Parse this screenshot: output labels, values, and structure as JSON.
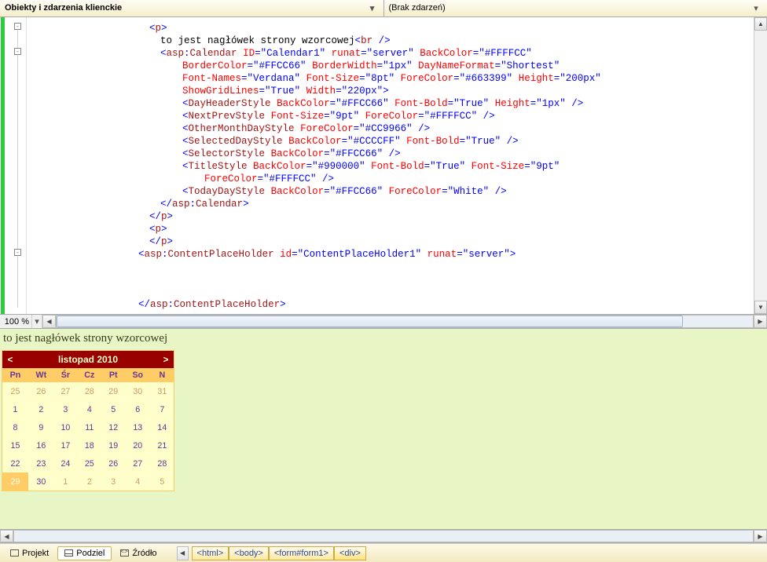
{
  "topbar": {
    "left_label": "Obiekty i zdarzenia klienckie",
    "right_label": "(Brak zdarzeń)"
  },
  "code_lines": [
    {
      "indent": 10,
      "segs": [
        {
          "c": "t-punct",
          "t": "<"
        },
        {
          "c": "t-tag",
          "t": "p"
        },
        {
          "c": "t-punct",
          "t": ">"
        }
      ]
    },
    {
      "indent": 12,
      "segs": [
        {
          "c": "t-black",
          "t": "to jest nagłówek strony wzorcowej"
        },
        {
          "c": "t-punct",
          "t": "<"
        },
        {
          "c": "t-tag",
          "t": "br"
        },
        {
          "c": "t-black",
          "t": " "
        },
        {
          "c": "t-punct",
          "t": "/>"
        }
      ]
    },
    {
      "indent": 12,
      "segs": [
        {
          "c": "t-punct",
          "t": "<"
        },
        {
          "c": "t-tag",
          "t": "asp"
        },
        {
          "c": "t-punct",
          "t": ":"
        },
        {
          "c": "t-tag",
          "t": "Calendar"
        },
        {
          "c": "",
          "t": " "
        },
        {
          "c": "t-attr",
          "t": "ID"
        },
        {
          "c": "t-punct",
          "t": "=\""
        },
        {
          "c": "t-val",
          "t": "Calendar1"
        },
        {
          "c": "t-punct",
          "t": "\" "
        },
        {
          "c": "t-attr",
          "t": "runat"
        },
        {
          "c": "t-punct",
          "t": "=\""
        },
        {
          "c": "t-val",
          "t": "server"
        },
        {
          "c": "t-punct",
          "t": "\" "
        },
        {
          "c": "t-attr",
          "t": "BackColor"
        },
        {
          "c": "t-punct",
          "t": "=\""
        },
        {
          "c": "t-val",
          "t": "#FFFFCC"
        },
        {
          "c": "t-punct",
          "t": "\""
        }
      ]
    },
    {
      "indent": 16,
      "segs": [
        {
          "c": "t-attr",
          "t": "BorderColor"
        },
        {
          "c": "t-punct",
          "t": "=\""
        },
        {
          "c": "t-val",
          "t": "#FFCC66"
        },
        {
          "c": "t-punct",
          "t": "\" "
        },
        {
          "c": "t-attr",
          "t": "BorderWidth"
        },
        {
          "c": "t-punct",
          "t": "=\""
        },
        {
          "c": "t-val",
          "t": "1px"
        },
        {
          "c": "t-punct",
          "t": "\" "
        },
        {
          "c": "t-attr",
          "t": "DayNameFormat"
        },
        {
          "c": "t-punct",
          "t": "=\""
        },
        {
          "c": "t-val",
          "t": "Shortest"
        },
        {
          "c": "t-punct",
          "t": "\""
        }
      ]
    },
    {
      "indent": 16,
      "segs": [
        {
          "c": "t-attr",
          "t": "Font-Names"
        },
        {
          "c": "t-punct",
          "t": "=\""
        },
        {
          "c": "t-val",
          "t": "Verdana"
        },
        {
          "c": "t-punct",
          "t": "\" "
        },
        {
          "c": "t-attr",
          "t": "Font-Size"
        },
        {
          "c": "t-punct",
          "t": "=\""
        },
        {
          "c": "t-val",
          "t": "8pt"
        },
        {
          "c": "t-punct",
          "t": "\" "
        },
        {
          "c": "t-attr",
          "t": "ForeColor"
        },
        {
          "c": "t-punct",
          "t": "=\""
        },
        {
          "c": "t-val",
          "t": "#663399"
        },
        {
          "c": "t-punct",
          "t": "\" "
        },
        {
          "c": "t-attr",
          "t": "Height"
        },
        {
          "c": "t-punct",
          "t": "=\""
        },
        {
          "c": "t-val",
          "t": "200px"
        },
        {
          "c": "t-punct",
          "t": "\""
        }
      ]
    },
    {
      "indent": 16,
      "segs": [
        {
          "c": "t-attr",
          "t": "ShowGridLines"
        },
        {
          "c": "t-punct",
          "t": "=\""
        },
        {
          "c": "t-val",
          "t": "True"
        },
        {
          "c": "t-punct",
          "t": "\" "
        },
        {
          "c": "t-attr",
          "t": "Width"
        },
        {
          "c": "t-punct",
          "t": "=\""
        },
        {
          "c": "t-val",
          "t": "220px"
        },
        {
          "c": "t-punct",
          "t": "\">"
        }
      ]
    },
    {
      "indent": 16,
      "segs": [
        {
          "c": "t-punct",
          "t": "<"
        },
        {
          "c": "t-tag",
          "t": "DayHeaderStyle"
        },
        {
          "c": "",
          "t": " "
        },
        {
          "c": "t-attr",
          "t": "BackColor"
        },
        {
          "c": "t-punct",
          "t": "=\""
        },
        {
          "c": "t-val",
          "t": "#FFCC66"
        },
        {
          "c": "t-punct",
          "t": "\" "
        },
        {
          "c": "t-attr",
          "t": "Font-Bold"
        },
        {
          "c": "t-punct",
          "t": "=\""
        },
        {
          "c": "t-val",
          "t": "True"
        },
        {
          "c": "t-punct",
          "t": "\" "
        },
        {
          "c": "t-attr",
          "t": "Height"
        },
        {
          "c": "t-punct",
          "t": "=\""
        },
        {
          "c": "t-val",
          "t": "1px"
        },
        {
          "c": "t-punct",
          "t": "\" />"
        }
      ]
    },
    {
      "indent": 16,
      "segs": [
        {
          "c": "t-punct",
          "t": "<"
        },
        {
          "c": "t-tag",
          "t": "NextPrevStyle"
        },
        {
          "c": "",
          "t": " "
        },
        {
          "c": "t-attr",
          "t": "Font-Size"
        },
        {
          "c": "t-punct",
          "t": "=\""
        },
        {
          "c": "t-val",
          "t": "9pt"
        },
        {
          "c": "t-punct",
          "t": "\" "
        },
        {
          "c": "t-attr",
          "t": "ForeColor"
        },
        {
          "c": "t-punct",
          "t": "=\""
        },
        {
          "c": "t-val",
          "t": "#FFFFCC"
        },
        {
          "c": "t-punct",
          "t": "\" />"
        }
      ]
    },
    {
      "indent": 16,
      "segs": [
        {
          "c": "t-punct",
          "t": "<"
        },
        {
          "c": "t-tag",
          "t": "OtherMonthDayStyle"
        },
        {
          "c": "",
          "t": " "
        },
        {
          "c": "t-attr",
          "t": "ForeColor"
        },
        {
          "c": "t-punct",
          "t": "=\""
        },
        {
          "c": "t-val",
          "t": "#CC9966"
        },
        {
          "c": "t-punct",
          "t": "\" />"
        }
      ]
    },
    {
      "indent": 16,
      "segs": [
        {
          "c": "t-punct",
          "t": "<"
        },
        {
          "c": "t-tag",
          "t": "SelectedDayStyle"
        },
        {
          "c": "",
          "t": " "
        },
        {
          "c": "t-attr",
          "t": "BackColor"
        },
        {
          "c": "t-punct",
          "t": "=\""
        },
        {
          "c": "t-val",
          "t": "#CCCCFF"
        },
        {
          "c": "t-punct",
          "t": "\" "
        },
        {
          "c": "t-attr",
          "t": "Font-Bold"
        },
        {
          "c": "t-punct",
          "t": "=\""
        },
        {
          "c": "t-val",
          "t": "True"
        },
        {
          "c": "t-punct",
          "t": "\" />"
        }
      ]
    },
    {
      "indent": 16,
      "segs": [
        {
          "c": "t-punct",
          "t": "<"
        },
        {
          "c": "t-tag",
          "t": "SelectorStyle"
        },
        {
          "c": "",
          "t": " "
        },
        {
          "c": "t-attr",
          "t": "BackColor"
        },
        {
          "c": "t-punct",
          "t": "=\""
        },
        {
          "c": "t-val",
          "t": "#FFCC66"
        },
        {
          "c": "t-punct",
          "t": "\" />"
        }
      ]
    },
    {
      "indent": 16,
      "segs": [
        {
          "c": "t-punct",
          "t": "<"
        },
        {
          "c": "t-tag",
          "t": "TitleStyle"
        },
        {
          "c": "",
          "t": " "
        },
        {
          "c": "t-attr",
          "t": "BackColor"
        },
        {
          "c": "t-punct",
          "t": "=\""
        },
        {
          "c": "t-val",
          "t": "#990000"
        },
        {
          "c": "t-punct",
          "t": "\" "
        },
        {
          "c": "t-attr",
          "t": "Font-Bold"
        },
        {
          "c": "t-punct",
          "t": "=\""
        },
        {
          "c": "t-val",
          "t": "True"
        },
        {
          "c": "t-punct",
          "t": "\" "
        },
        {
          "c": "t-attr",
          "t": "Font-Size"
        },
        {
          "c": "t-punct",
          "t": "=\""
        },
        {
          "c": "t-val",
          "t": "9pt"
        },
        {
          "c": "t-punct",
          "t": "\""
        }
      ]
    },
    {
      "indent": 20,
      "segs": [
        {
          "c": "t-attr",
          "t": "ForeColor"
        },
        {
          "c": "t-punct",
          "t": "=\""
        },
        {
          "c": "t-val",
          "t": "#FFFFCC"
        },
        {
          "c": "t-punct",
          "t": "\" />"
        }
      ]
    },
    {
      "indent": 16,
      "segs": [
        {
          "c": "t-punct",
          "t": "<"
        },
        {
          "c": "t-tag",
          "t": "TodayDayStyle"
        },
        {
          "c": "",
          "t": " "
        },
        {
          "c": "t-attr",
          "t": "BackColor"
        },
        {
          "c": "t-punct",
          "t": "=\""
        },
        {
          "c": "t-val",
          "t": "#FFCC66"
        },
        {
          "c": "t-punct",
          "t": "\" "
        },
        {
          "c": "t-attr",
          "t": "ForeColor"
        },
        {
          "c": "t-punct",
          "t": "=\""
        },
        {
          "c": "t-val",
          "t": "White"
        },
        {
          "c": "t-punct",
          "t": "\" />"
        }
      ]
    },
    {
      "indent": 12,
      "segs": [
        {
          "c": "t-punct",
          "t": "</"
        },
        {
          "c": "t-tag",
          "t": "asp"
        },
        {
          "c": "t-punct",
          "t": ":"
        },
        {
          "c": "t-tag",
          "t": "Calendar"
        },
        {
          "c": "t-punct",
          "t": ">"
        }
      ]
    },
    {
      "indent": 10,
      "segs": [
        {
          "c": "t-punct",
          "t": "</"
        },
        {
          "c": "t-tag",
          "t": "p"
        },
        {
          "c": "t-punct",
          "t": ">"
        }
      ]
    },
    {
      "indent": 10,
      "segs": [
        {
          "c": "t-punct",
          "t": "<"
        },
        {
          "c": "t-tag",
          "t": "p"
        },
        {
          "c": "t-punct",
          "t": ">"
        }
      ]
    },
    {
      "indent": 10,
      "segs": [
        {
          "c": "t-punct",
          "t": "</"
        },
        {
          "c": "t-tag",
          "t": "p"
        },
        {
          "c": "t-punct",
          "t": ">"
        }
      ]
    },
    {
      "indent": 8,
      "segs": [
        {
          "c": "t-punct",
          "t": "<"
        },
        {
          "c": "t-tag",
          "t": "asp"
        },
        {
          "c": "t-punct",
          "t": ":"
        },
        {
          "c": "t-tag",
          "t": "ContentPlaceHolder"
        },
        {
          "c": "",
          "t": " "
        },
        {
          "c": "t-attr",
          "t": "id"
        },
        {
          "c": "t-punct",
          "t": "=\""
        },
        {
          "c": "t-val",
          "t": "ContentPlaceHolder1"
        },
        {
          "c": "t-punct",
          "t": "\" "
        },
        {
          "c": "t-attr",
          "t": "runat"
        },
        {
          "c": "t-punct",
          "t": "=\""
        },
        {
          "c": "t-val",
          "t": "server"
        },
        {
          "c": "t-punct",
          "t": "\">"
        }
      ]
    },
    {
      "indent": 0,
      "segs": []
    },
    {
      "indent": 0,
      "segs": []
    },
    {
      "indent": 0,
      "segs": []
    },
    {
      "indent": 8,
      "segs": [
        {
          "c": "t-punct",
          "t": "</"
        },
        {
          "c": "t-tag",
          "t": "asp"
        },
        {
          "c": "t-punct",
          "t": ":"
        },
        {
          "c": "t-tag",
          "t": "ContentPlaceHolder"
        },
        {
          "c": "t-punct",
          "t": ">"
        }
      ]
    }
  ],
  "zoom": "100 %",
  "preview": {
    "header_text": "to jest nagłówek strony wzorcowej",
    "calendar": {
      "prev": "<",
      "next": ">",
      "title": "listopad 2010",
      "day_headers": [
        "Pn",
        "Wt",
        "Śr",
        "Cz",
        "Pt",
        "So",
        "N"
      ],
      "weeks": [
        [
          {
            "d": "25",
            "o": true
          },
          {
            "d": "26",
            "o": true
          },
          {
            "d": "27",
            "o": true
          },
          {
            "d": "28",
            "o": true
          },
          {
            "d": "29",
            "o": true
          },
          {
            "d": "30",
            "o": true
          },
          {
            "d": "31",
            "o": true
          }
        ],
        [
          {
            "d": "1"
          },
          {
            "d": "2"
          },
          {
            "d": "3"
          },
          {
            "d": "4"
          },
          {
            "d": "5"
          },
          {
            "d": "6"
          },
          {
            "d": "7"
          }
        ],
        [
          {
            "d": "8"
          },
          {
            "d": "9"
          },
          {
            "d": "10"
          },
          {
            "d": "11"
          },
          {
            "d": "12"
          },
          {
            "d": "13"
          },
          {
            "d": "14"
          }
        ],
        [
          {
            "d": "15"
          },
          {
            "d": "16"
          },
          {
            "d": "17"
          },
          {
            "d": "18"
          },
          {
            "d": "19"
          },
          {
            "d": "20"
          },
          {
            "d": "21"
          }
        ],
        [
          {
            "d": "22"
          },
          {
            "d": "23"
          },
          {
            "d": "24"
          },
          {
            "d": "25"
          },
          {
            "d": "26"
          },
          {
            "d": "27"
          },
          {
            "d": "28"
          }
        ],
        [
          {
            "d": "29",
            "t": true
          },
          {
            "d": "30"
          },
          {
            "d": "1",
            "o": true
          },
          {
            "d": "2",
            "o": true
          },
          {
            "d": "3",
            "o": true
          },
          {
            "d": "4",
            "o": true
          },
          {
            "d": "5",
            "o": true
          }
        ]
      ]
    }
  },
  "bottom": {
    "views": [
      {
        "label": "Projekt",
        "icon": "design"
      },
      {
        "label": "Podziel",
        "icon": "split",
        "active": true
      },
      {
        "label": "Źródło",
        "icon": "src"
      }
    ],
    "breadcrumb": [
      "<html>",
      "<body>",
      "<form#form1>",
      "<div>"
    ]
  }
}
